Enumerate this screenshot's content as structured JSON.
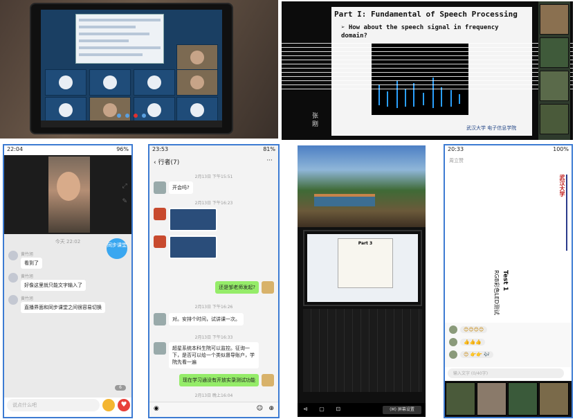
{
  "slide_b": {
    "title": "Part I: Fundamental of Speech Processing",
    "bullet": "How about the speech signal in frequency domain?",
    "logo": "武汉大学 电子信息学院",
    "side_label": "张 刚"
  },
  "phone_c": {
    "time": "22:04",
    "battery": "96%",
    "chat_time": "今天 22:02",
    "sync_label": "同步课堂",
    "messages": [
      {
        "name": "黄竹旭",
        "text": "看到了"
      },
      {
        "name": "黄竹旭",
        "text": "好像这里就只能文字输入了"
      },
      {
        "name": "黄竹旭",
        "text": "直播界面和同步课堂之间很容易切换"
      }
    ],
    "input_placeholder": "说点什么吧",
    "count": "6"
  },
  "phone_d": {
    "time": "23:53",
    "battery": "81%",
    "title": "行者(7)",
    "more": "···",
    "dates": [
      "2月13日 下午15:51",
      "2月13日 下午16:23",
      "2月13日 下午16:26",
      "2月13日 下午16:33",
      "2月13日 晚上16:04"
    ],
    "messages": [
      {
        "side": "left",
        "text": "开会吗?"
      },
      {
        "side": "right",
        "text": "还是邹老师发起?"
      },
      {
        "side": "left",
        "text": "对。安排个时间，试讲课一次。"
      },
      {
        "side": "left",
        "text": "超星系统本科生院可以监控。征询一下，是否可以给一个类似督导账户，学院先看一遍"
      },
      {
        "side": "right",
        "text": "现在学习通没有开放实录测试功能"
      }
    ]
  },
  "panel_e": {
    "nav_button": "(M) 屏幕设置",
    "slide_title": "Part 3"
  },
  "phone_f": {
    "time": "20:33",
    "battery": "100%",
    "top_label": "周立赞",
    "test_title": "Test 1",
    "test_sub": "RGB彩色LED测试",
    "school": "武汉大学",
    "chats": [
      "😊😊😊😊",
      "👍👍👍",
      "😊 👉👉 🎶"
    ],
    "input_placeholder": "输入文字 (0/40字)"
  }
}
